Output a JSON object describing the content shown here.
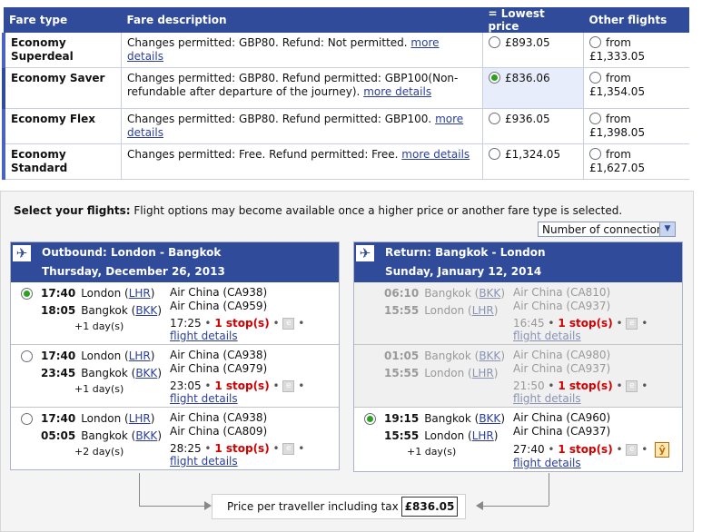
{
  "fares": {
    "headers": [
      "Fare type",
      "Fare description",
      "= Lowest price",
      "Other flights"
    ],
    "rows": [
      {
        "type": "Economy Superdeal",
        "desc": "Changes permitted: GBP80. Refund: Not permitted.",
        "link": "more details",
        "price": "£893.05",
        "other": "from £1,333.05"
      },
      {
        "type": "Economy Saver",
        "desc": "Changes permitted: GBP80. Refund permitted: GBP100(Non-refundable after departure of the journey).",
        "link": "more details",
        "price": "£836.06",
        "other": "from £1,354.05"
      },
      {
        "type": "Economy Flex",
        "desc": "Changes permitted: GBP80. Refund permitted: GBP100.",
        "link": "more details",
        "price": "£936.05",
        "other": "from £1,398.05"
      },
      {
        "type": "Economy Standard",
        "desc": "Changes permitted: Free. Refund permitted: Free.",
        "link": "more details",
        "price": "£1,324.05",
        "other": "from £1,627.05"
      }
    ]
  },
  "select": {
    "title": "Select your flights:",
    "note": " Flight options may become available once a higher price or another fare type is selected.",
    "connections": "Number of connections"
  },
  "outbound": {
    "route": "Outbound: London - Bangkok",
    "date": "Thursday, December 26, 2013",
    "options": [
      {
        "dep_time": "17:40",
        "dep_city": "London",
        "dep_code": "LHR",
        "arr_time": "18:05",
        "arr_city": "Bangkok",
        "arr_code": "BKK",
        "days": "+1 day(s)",
        "air1": "Air China (CA938)",
        "air2": "Air China (CA959)",
        "duration": "17:25",
        "stops": "1 stop(s)",
        "details": "flight details"
      },
      {
        "dep_time": "17:40",
        "dep_city": "London",
        "dep_code": "LHR",
        "arr_time": "23:45",
        "arr_city": "Bangkok",
        "arr_code": "BKK",
        "days": "+1 day(s)",
        "air1": "Air China (CA938)",
        "air2": "Air China (CA979)",
        "duration": "23:05",
        "stops": "1 stop(s)",
        "details": "flight details"
      },
      {
        "dep_time": "17:40",
        "dep_city": "London",
        "dep_code": "LHR",
        "arr_time": "05:05",
        "arr_city": "Bangkok",
        "arr_code": "BKK",
        "days": "+2 day(s)",
        "air1": "Air China (CA938)",
        "air2": "Air China (CA809)",
        "duration": "28:25",
        "stops": "1 stop(s)",
        "details": "flight details"
      }
    ]
  },
  "return": {
    "route": "Return: Bangkok - London",
    "date": "Sunday, January 12, 2014",
    "options": [
      {
        "dep_time": "06:10",
        "dep_city": "Bangkok",
        "dep_code": "BKK",
        "arr_time": "15:55",
        "arr_city": "London",
        "arr_code": "LHR",
        "days": "",
        "air1": "Air China (CA810)",
        "air2": "Air China (CA937)",
        "duration": "16:45",
        "stops": "1 stop(s)",
        "details": "flight details"
      },
      {
        "dep_time": "01:05",
        "dep_city": "Bangkok",
        "dep_code": "BKK",
        "arr_time": "15:55",
        "arr_city": "London",
        "arr_code": "LHR",
        "days": "",
        "air1": "Air China (CA980)",
        "air2": "Air China (CA937)",
        "duration": "21:50",
        "stops": "1 stop(s)",
        "details": "flight details"
      },
      {
        "dep_time": "19:15",
        "dep_city": "Bangkok",
        "dep_code": "BKK",
        "arr_time": "15:55",
        "arr_city": "London",
        "arr_code": "LHR",
        "days": "+1 day(s)",
        "air1": "Air China (CA960)",
        "air2": "Air China (CA937)",
        "duration": "27:40",
        "stops": "1 stop(s)",
        "details": "flight details"
      }
    ]
  },
  "total": {
    "label": "Price per traveller including tax",
    "value": "£836.05"
  },
  "icons": {
    "ebox": "e",
    "wifi": "ŷ"
  }
}
